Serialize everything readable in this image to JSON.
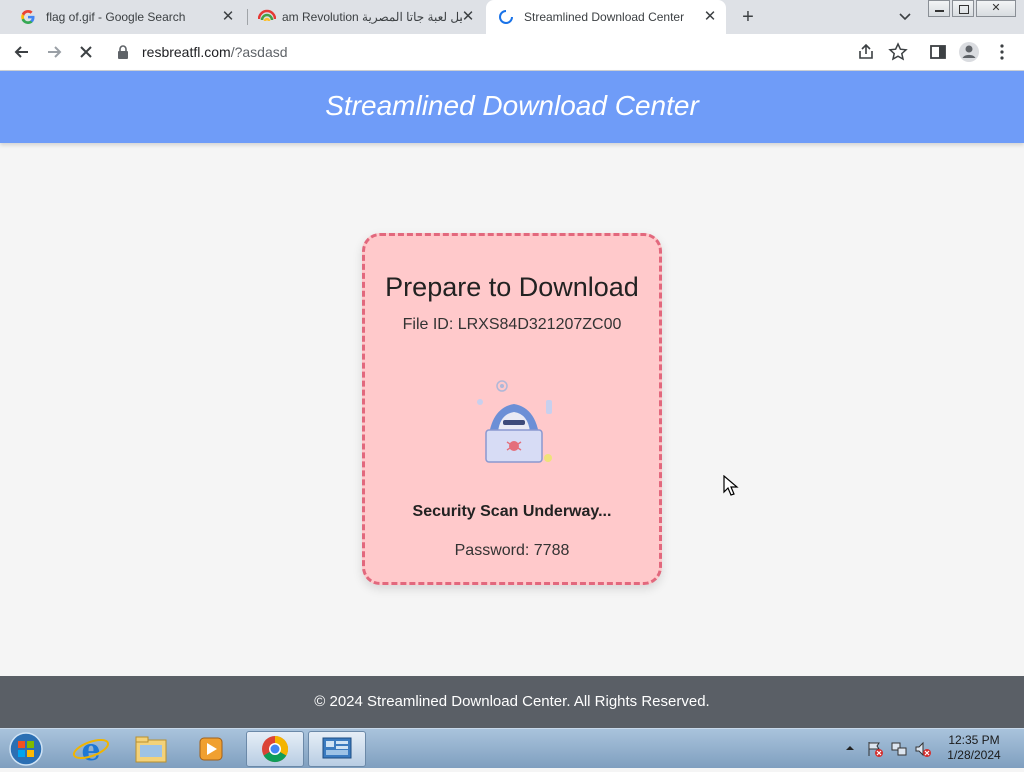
{
  "browser": {
    "tabs": [
      {
        "title": "flag of.gif - Google Search",
        "active": false
      },
      {
        "title": "am Revolution تحميل لعبة جاتا المصرية",
        "active": false
      },
      {
        "title": "Streamlined Download Center",
        "active": true
      }
    ],
    "url_domain": "resbreatfl.com",
    "url_path": "/?asdasd"
  },
  "page": {
    "header_title": "Streamlined Download Center",
    "card": {
      "title": "Prepare to Download",
      "file_id": "File ID: LRXS84D321207ZC00",
      "scan_status": "Security Scan Underway...",
      "password": "Password: 7788"
    },
    "footer": "© 2024 Streamlined Download Center. All Rights Reserved."
  },
  "taskbar": {
    "time": "12:35 PM",
    "date": "1/28/2024"
  },
  "colors": {
    "header_bg": "#6f9cf8",
    "card_bg": "#ffc9cb",
    "card_border": "#e2687d",
    "footer_bg": "#5a5f66"
  }
}
